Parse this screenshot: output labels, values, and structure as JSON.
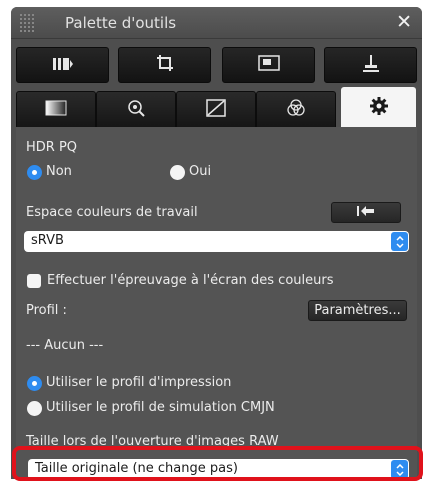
{
  "window": {
    "title": "Palette d'outils",
    "close_glyph": "✕"
  },
  "toolbar_row1": [
    {
      "icon": "adjust-panel-icon"
    },
    {
      "icon": "crop-icon"
    },
    {
      "icon": "image-stamp-icon"
    },
    {
      "icon": "level-adjust-icon"
    }
  ],
  "toolbar_row2": [
    {
      "icon": "brightness-icon"
    },
    {
      "icon": "lens-correction-icon"
    },
    {
      "icon": "tone-curve-icon"
    },
    {
      "icon": "color-wheel-icon"
    },
    {
      "icon": "settings-gear-icon",
      "active": true
    }
  ],
  "hdr": {
    "label": "HDR PQ",
    "options": [
      {
        "label": "Non",
        "selected": true
      },
      {
        "label": "Oui",
        "selected": false
      }
    ]
  },
  "workspace": {
    "label": "Espace couleurs de travail",
    "reset_icon": "undo-arrow-icon",
    "value": "sRVB"
  },
  "proofing": {
    "checkbox_label": "Effectuer l'épreuvage à l'écran des couleurs",
    "checked": false,
    "profile_label": "Profil :",
    "settings_button": "Paramètres...",
    "profile_value": "---  Aucun  ---",
    "options": [
      {
        "label": "Utiliser le profil d'impression",
        "selected": true
      },
      {
        "label": "Utiliser le profil de simulation CMJN",
        "selected": false
      }
    ]
  },
  "raw_size": {
    "label": "Taille lors de l'ouverture d'images RAW",
    "value": "Taille originale (ne change pas)"
  },
  "colors": {
    "accent": "#2e8cf0",
    "highlight": "#e0121b",
    "panel": "#545454"
  }
}
